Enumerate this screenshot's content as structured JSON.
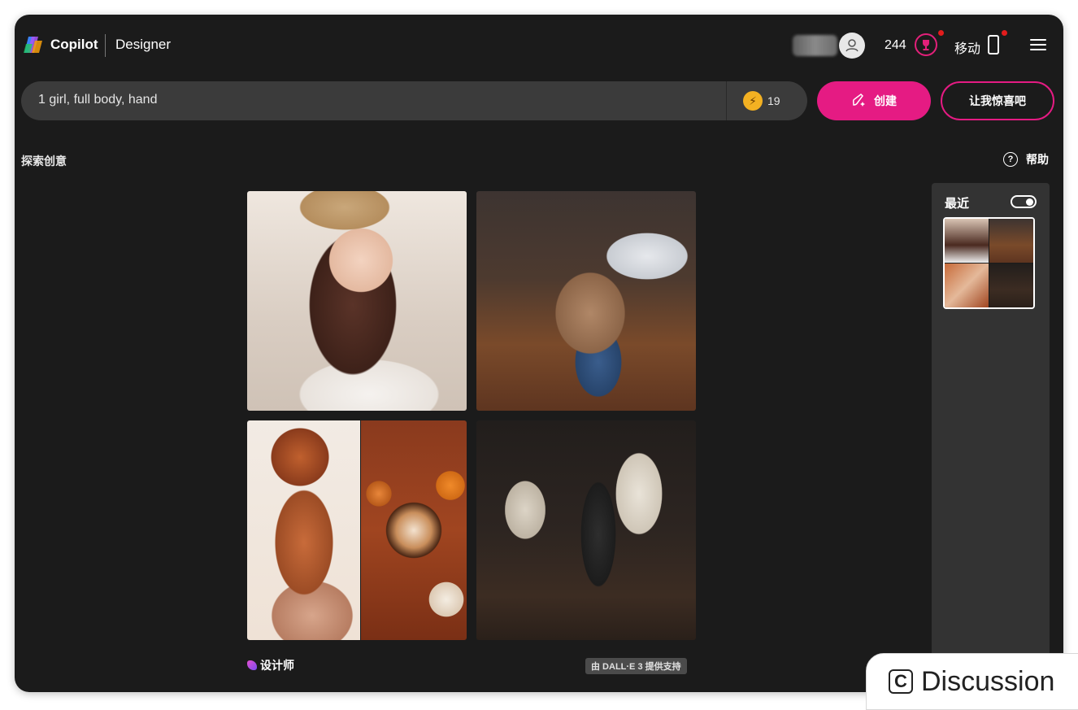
{
  "header": {
    "brand": "Copilot",
    "product": "Designer",
    "points": "244",
    "mobile_label": "移动"
  },
  "prompt": {
    "value": "1 girl, full body, hand",
    "boost_count": "19",
    "create_label": "创建",
    "surprise_label": "让我惊喜吧"
  },
  "explore_label": "探索创意",
  "help_label": "帮助",
  "results": {
    "designer_label": "设计师",
    "dalle_badge": "由 DALL·E 3 提供支持"
  },
  "recent": {
    "title": "最近",
    "toggle_on": true
  },
  "discussion": {
    "label": "Discussion"
  },
  "colors": {
    "background": "#1b1b1b",
    "accent": "#e51b83",
    "panel": "#333333"
  }
}
